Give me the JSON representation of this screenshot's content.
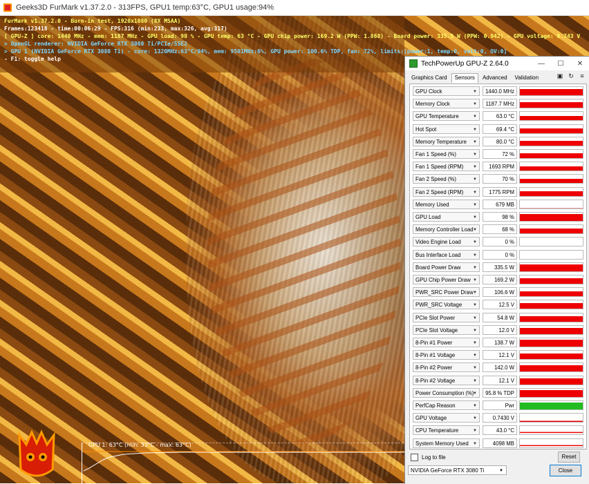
{
  "furmark": {
    "window_title": "Geeks3D FurMark v1.37.2.0 - 313FPS, GPU1 temp:63°C, GPU1 usage:94%",
    "osd_lines": [
      "FurMark v1.37.2.0 - Burn-in test, 1920x1080 (8X MSAA)",
      "Frames:123418 - time:00:06:29 - FPS:316 (min:233, max:326, avg:317)",
      "[ GPU-Z ] core: 1440 MHz - mem: 1187 MHz - GPU load: 98 % - GPU temp: 63 °C - GPU chip power: 169.2 W (PPW: 1.868) - Board power: 335.5 W (PPW: 0.942) - GPU voltage: 0.743 V",
      "> OpenGL renderer: NVIDIA GeForce RTX 3080 Ti/PCIe/SSE2",
      "> GPU 1 (NVIDIA GeForce RTX 3080 Ti) - core: 1320MHz:63°C/94%, mem: 9501MHz:6%, GPU power: 100.6% TDP, fan: 72%, limits:[power:1, temp:0, volt:0, OV:0]",
      "- F1: toggle help"
    ],
    "graph_label": "GPU 1: 63°C (min: 33°C - max: 63°C)"
  },
  "gpuz": {
    "title": "TechPowerUp GPU-Z 2.64.0",
    "tabs": [
      "Graphics Card",
      "Sensors",
      "Advanced",
      "Validation"
    ],
    "active_tab": "Sensors",
    "tools": {
      "camera": "▣",
      "refresh": "↻",
      "menu": "≡"
    },
    "sensors": [
      {
        "name": "GPU Clock",
        "value": "1440.0 MHz",
        "level": 0.75,
        "type": "bar"
      },
      {
        "name": "Memory Clock",
        "value": "1187.7 MHz",
        "level": 0.7,
        "type": "bar"
      },
      {
        "name": "GPU Temperature",
        "value": "63.0 °C",
        "level": 0.5,
        "type": "bar"
      },
      {
        "name": "Hot Spot",
        "value": "69.4 °C",
        "level": 0.55,
        "type": "bar"
      },
      {
        "name": "Memory Temperature",
        "value": "80.0 °C",
        "level": 0.6,
        "type": "bar"
      },
      {
        "name": "Fan 1 Speed (%)",
        "value": "72 %",
        "level": 0.55,
        "type": "bar"
      },
      {
        "name": "Fan 1 Speed (RPM)",
        "value": "1693 RPM",
        "level": 0.5,
        "type": "bar"
      },
      {
        "name": "Fan 2 Speed (%)",
        "value": "70 %",
        "level": 0.55,
        "type": "bar"
      },
      {
        "name": "Fan 2 Speed (RPM)",
        "value": "1775 RPM",
        "level": 0.55,
        "type": "bar"
      },
      {
        "name": "Memory Used",
        "value": "679 MB",
        "level": 0.05,
        "type": "line"
      },
      {
        "name": "GPU Load",
        "value": "98 %",
        "level": 0.85,
        "type": "bar"
      },
      {
        "name": "Memory Controller Load",
        "value": "68 %",
        "level": 0.6,
        "type": "bar"
      },
      {
        "name": "Video Engine Load",
        "value": "0 %",
        "level": 0,
        "type": "empty"
      },
      {
        "name": "Bus Interface Load",
        "value": "0 %",
        "level": 0,
        "type": "empty"
      },
      {
        "name": "Board Power Draw",
        "value": "335.5 W",
        "level": 0.8,
        "type": "bar"
      },
      {
        "name": "GPU Chip Power Draw",
        "value": "169.2 W",
        "level": 0.65,
        "type": "bar"
      },
      {
        "name": "PWR_SRC Power Draw",
        "value": "106.6 W",
        "level": 0.6,
        "type": "bar"
      },
      {
        "name": "PWR_SRC Voltage",
        "value": "12.5 V",
        "level": 0.7,
        "type": "bar"
      },
      {
        "name": "PCIe Slot Power",
        "value": "54.8 W",
        "level": 0.6,
        "type": "bar"
      },
      {
        "name": "PCIe Slot Voltage",
        "value": "12.0 V",
        "level": 0.75,
        "type": "bar"
      },
      {
        "name": "8-Pin #1 Power",
        "value": "138.7 W",
        "level": 0.8,
        "type": "bar"
      },
      {
        "name": "8-Pin #1 Voltage",
        "value": "12.1 V",
        "level": 0.7,
        "type": "bar"
      },
      {
        "name": "8-Pin #2 Power",
        "value": "142.0 W",
        "level": 0.8,
        "type": "bar"
      },
      {
        "name": "8-Pin #2 Voltage",
        "value": "12.1 V",
        "level": 0.7,
        "type": "bar"
      },
      {
        "name": "Power Consumption (%)",
        "value": "95.8 % TDP",
        "level": 0.8,
        "type": "bar"
      },
      {
        "name": "PerfCap Reason",
        "value": "Pwr",
        "level": 0.85,
        "type": "green"
      },
      {
        "name": "GPU Voltage",
        "value": "0.7430 V",
        "level": 0.15,
        "type": "line"
      },
      {
        "name": "CPU Temperature",
        "value": "43.0 °C",
        "level": 0.3,
        "type": "line"
      },
      {
        "name": "System Memory Used",
        "value": "4098 MB",
        "level": 0.3,
        "type": "line"
      }
    ],
    "log_label": "Log to file",
    "reset_label": "Reset",
    "gpu_select": "NVIDIA GeForce RTX 3080 Ti",
    "close_label": "Close",
    "colors": {
      "bar": "#ee0000",
      "green": "#22bb22"
    }
  }
}
